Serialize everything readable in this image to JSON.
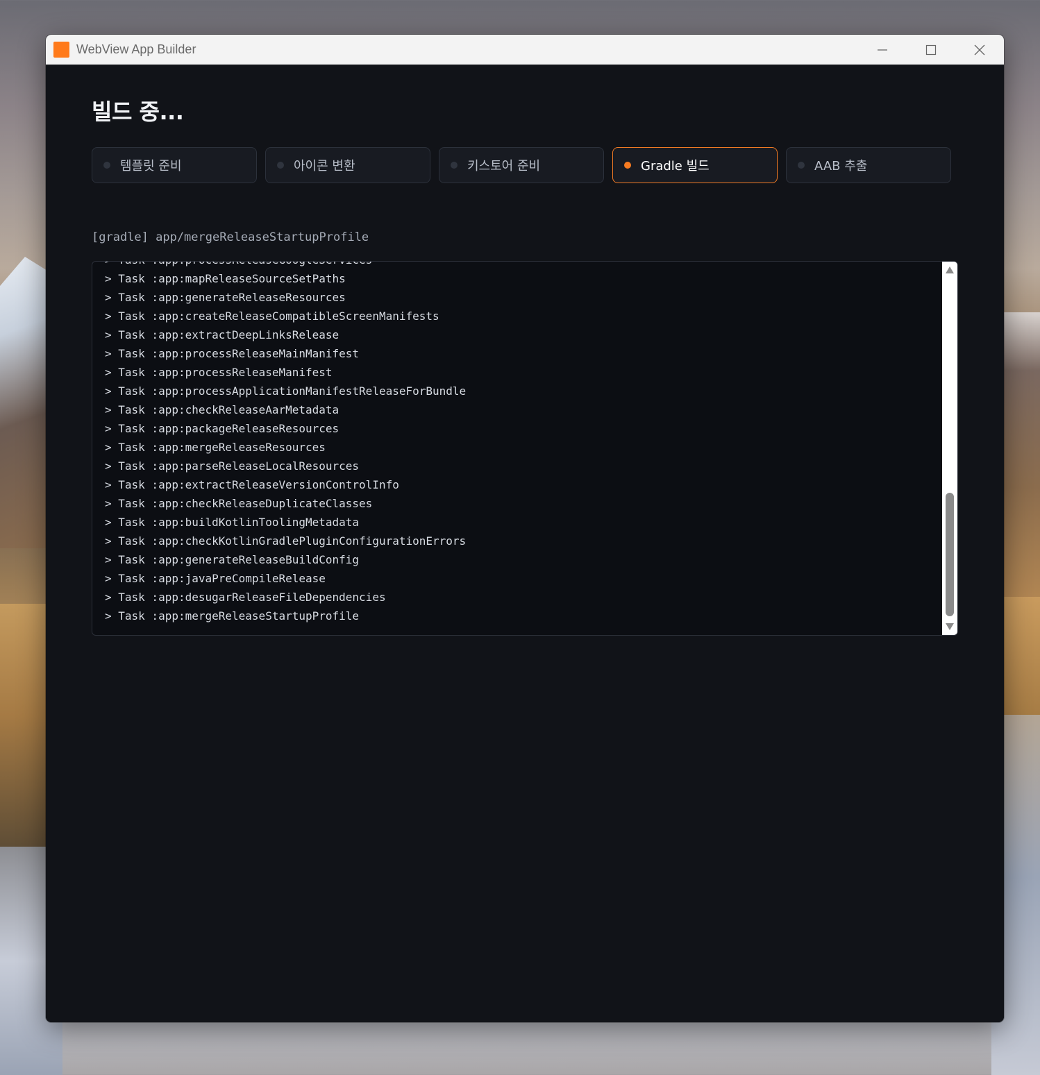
{
  "window": {
    "title": "WebView App Builder",
    "controls": {
      "minimize_icon": "minimize-icon",
      "maximize_icon": "maximize-icon",
      "close_icon": "close-icon"
    }
  },
  "page": {
    "title": "빌드 중..."
  },
  "steps": [
    {
      "label": "템플릿 준비",
      "state": "pending"
    },
    {
      "label": "아이콘 변환",
      "state": "pending"
    },
    {
      "label": "키스토어 준비",
      "state": "pending"
    },
    {
      "label": "Gradle 빌드",
      "state": "active"
    },
    {
      "label": "AAB 추출",
      "state": "pending"
    }
  ],
  "status_line": "[gradle] app/mergeReleaseStartupProfile",
  "log": [
    "> Task :app:processReleaseGoogleServices",
    "> Task :app:mapReleaseSourceSetPaths",
    "> Task :app:generateReleaseResources",
    "> Task :app:createReleaseCompatibleScreenManifests",
    "> Task :app:extractDeepLinksRelease",
    "> Task :app:processReleaseMainManifest",
    "> Task :app:processReleaseManifest",
    "> Task :app:processApplicationManifestReleaseForBundle",
    "> Task :app:checkReleaseAarMetadata",
    "> Task :app:packageReleaseResources",
    "> Task :app:mergeReleaseResources",
    "> Task :app:parseReleaseLocalResources",
    "> Task :app:extractReleaseVersionControlInfo",
    "> Task :app:checkReleaseDuplicateClasses",
    "> Task :app:buildKotlinToolingMetadata",
    "> Task :app:checkKotlinGradlePluginConfigurationErrors",
    "> Task :app:generateReleaseBuildConfig",
    "> Task :app:javaPreCompileRelease",
    "> Task :app:desugarReleaseFileDependencies",
    "> Task :app:mergeReleaseStartupProfile"
  ],
  "colors": {
    "accent": "#f77b21",
    "background": "#111318",
    "log_background": "#0c0e13"
  }
}
